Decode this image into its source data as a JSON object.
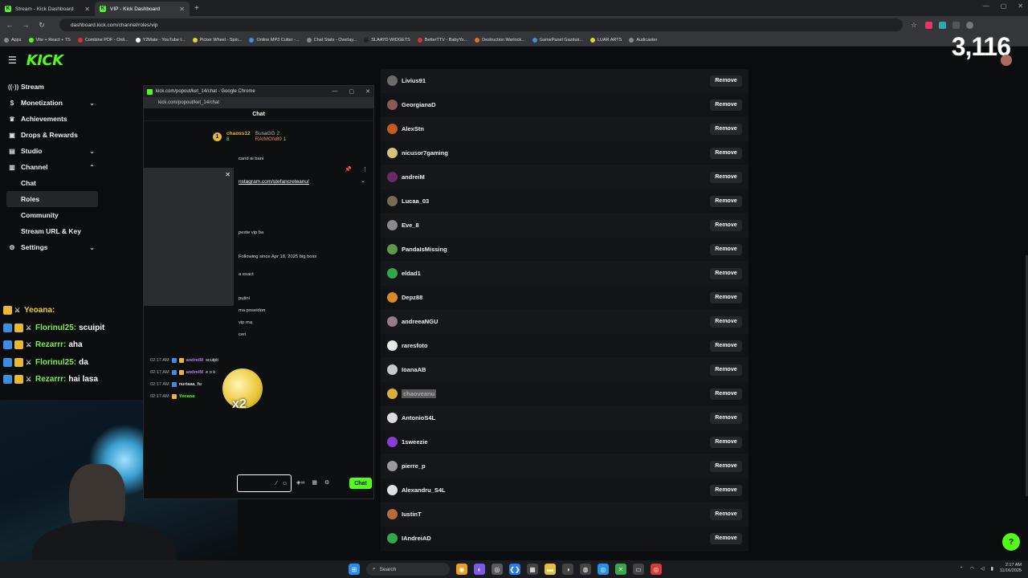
{
  "browser": {
    "tabs": [
      {
        "title": "Stream - Kick Dashboard",
        "active": false
      },
      {
        "title": "VIP - Kick Dashboard",
        "active": true
      }
    ],
    "url": "dashboard.kick.com/channel/roles/vip",
    "bookmarks": [
      "Apps",
      "Vite + React + TS",
      "Combine PDF - Onli...",
      "Y2Mate - YouTube t...",
      "Picker Wheel - Spin...",
      "Online MP3 Cutter -...",
      "Chat Stats - Overlay...",
      "SLAAYD WIDGETS",
      "BetterTTV - BabyYo...",
      "Destruction Warlock...",
      "GamePanel Gazduir...",
      "LUAR ARTS",
      "Audicaster"
    ]
  },
  "header": {
    "logo": "KICK",
    "viewer_count": "3,116"
  },
  "sidebar": {
    "items": [
      {
        "label": "Stream",
        "icon": "broadcast-icon",
        "chevron": ""
      },
      {
        "label": "Monetization",
        "icon": "dollar-icon",
        "chevron": "down"
      },
      {
        "label": "Achievements",
        "icon": "trophy-icon",
        "chevron": ""
      },
      {
        "label": "Drops & Rewards",
        "icon": "gift-icon",
        "chevron": ""
      },
      {
        "label": "Studio",
        "icon": "studio-icon",
        "chevron": "down"
      },
      {
        "label": "Channel",
        "icon": "channel-icon",
        "chevron": "up"
      }
    ],
    "sub_items": [
      "Chat",
      "Roles",
      "Community",
      "Stream URL & Key"
    ],
    "active_sub": "Roles",
    "settings": "Settings"
  },
  "vip_list": {
    "remove_label": "Remove",
    "users": [
      {
        "name": "Livius91",
        "color": "#6b6b6b"
      },
      {
        "name": "GeorgianaD",
        "color": "#8a5a5a"
      },
      {
        "name": "AlexStn",
        "color": "#c05a20"
      },
      {
        "name": "nicusor7gaming",
        "color": "#d8c37a"
      },
      {
        "name": "andreiM",
        "color": "#6a2a6a"
      },
      {
        "name": "Lucaa_03",
        "color": "#7a6a50"
      },
      {
        "name": "Eve_8",
        "color": "#8a8a8a"
      },
      {
        "name": "PandaIsMissing",
        "color": "#5a9a4a"
      },
      {
        "name": "eldad1",
        "color": "#2ea84a"
      },
      {
        "name": "Depz88",
        "color": "#d88a2a"
      },
      {
        "name": "andreeaNGU",
        "color": "#9a7a8a"
      },
      {
        "name": "raresfoto",
        "color": "#e8e8e8"
      },
      {
        "name": "IoanaAB",
        "color": "#c8c8c8"
      },
      {
        "name": "chaoveanu",
        "color": "#d8b03a",
        "highlight": true
      },
      {
        "name": "AntonioS4L",
        "color": "#dcdcdc"
      },
      {
        "name": "1sweezie",
        "color": "#8a3ad8"
      },
      {
        "name": "pierre_p",
        "color": "#9a9a9a"
      },
      {
        "name": "Alexandru_S4L",
        "color": "#e0e0e0"
      },
      {
        "name": "IustinT",
        "color": "#b86a3a"
      },
      {
        "name": "IAndreiAD",
        "color": "#2ea84a"
      }
    ]
  },
  "popout": {
    "window_title": "kick.com/popout/ket_14/chat - Google Chrome",
    "url": "kick.com/popout/ket_14/chat",
    "header": "Chat",
    "leaderboard": {
      "first": "chaoss12",
      "first_count": "8",
      "second": "SusaGG",
      "second_count": "2",
      "third": "RAIMON89",
      "third_count": "1"
    },
    "pinned_text": "cand ai bani",
    "pinned_link": "nstagram.com/stefancreteanu/",
    "lines": [
      "peste vip ba",
      "Following since Apr 18, 2025 big boss",
      "a exact",
      "putini",
      "ma poseidon",
      "vip ma",
      "ceri"
    ],
    "messages": [
      {
        "time": "02:17 AM",
        "user": "andreiM",
        "text": "sculpit",
        "green": false
      },
      {
        "time": "02:17 AM",
        "user": "andreiM",
        "text": "e o k",
        "green": false
      },
      {
        "time": "02:17 AM",
        "user": "nuriaaa_fu",
        "text": "",
        "green": false
      },
      {
        "time": "02:17 AM",
        "user": "Yeoana",
        "text": "",
        "green": true
      }
    ],
    "emote_multiplier": "x2",
    "chat_button": "Chat"
  },
  "stream_chat": [
    {
      "user": "Yeoana:",
      "text": ""
    },
    {
      "user": "Florinul25:",
      "text": "scuipit"
    },
    {
      "user": "Rezarrr:",
      "text": "aha"
    },
    {
      "user": "Florinul25:",
      "text": "da"
    },
    {
      "user": "Rezarrr:",
      "text": "hai lasa"
    }
  ],
  "taskbar": {
    "search": "Search",
    "time": "2:17 AM",
    "date": "11/16/2025"
  },
  "colors": {
    "accent": "#53fc18",
    "background": "#0b0c0e"
  }
}
